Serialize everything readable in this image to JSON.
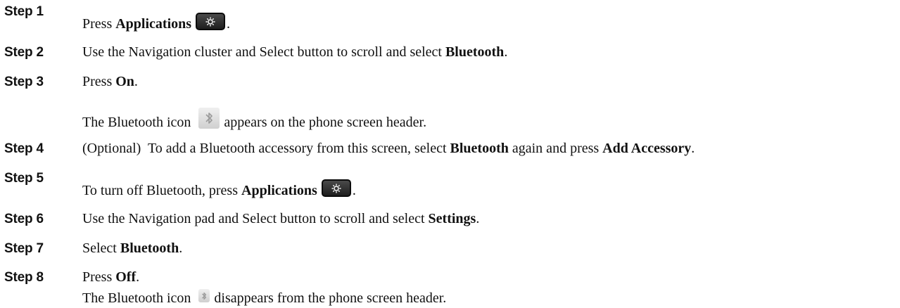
{
  "steps": [
    {
      "label": "Step 1",
      "parts": [
        "Press ",
        "Applications",
        "."
      ],
      "icon": "gear-icon"
    },
    {
      "label": "Step 2",
      "parts": [
        "Use the Navigation cluster and Select button to scroll and select ",
        "Bluetooth",
        "."
      ]
    },
    {
      "label": "Step 3",
      "parts": [
        "Press ",
        "On",
        "."
      ],
      "result": [
        "The Bluetooth icon ",
        "appears on the phone screen header."
      ],
      "result_icon": "bluetooth-icon"
    },
    {
      "label": "Step 4",
      "parts": [
        "(Optional)  To add a Bluetooth accessory from this screen, select ",
        "Bluetooth",
        " again and press ",
        "Add Accessory",
        "."
      ]
    },
    {
      "label": "Step 5",
      "parts": [
        "To turn off Bluetooth, press ",
        "Applications",
        "."
      ],
      "icon": "gear-icon"
    },
    {
      "label": "Step 6",
      "parts": [
        "Use the Navigation pad and Select button to scroll and select ",
        "Settings",
        "."
      ]
    },
    {
      "label": "Step 7",
      "parts": [
        "Select ",
        "Bluetooth",
        "."
      ]
    },
    {
      "label": "Step 8",
      "parts": [
        "Press ",
        "Off",
        "."
      ],
      "result": [
        "The Bluetooth icon ",
        "disappears from the phone screen header."
      ],
      "result_icon": "bluetooth-icon"
    }
  ],
  "colors": {
    "text": "#111111",
    "key_background": "#2b2b2b",
    "icon_background": "#dcdcdc"
  }
}
